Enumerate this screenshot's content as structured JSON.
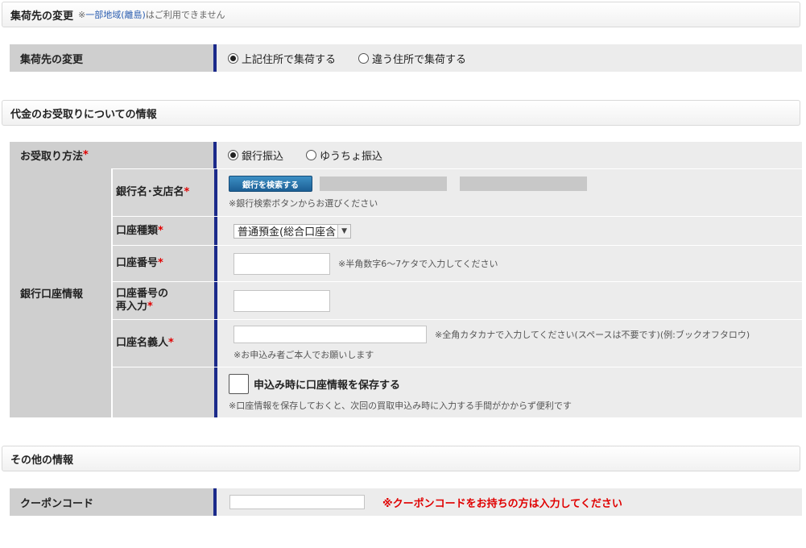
{
  "pickup": {
    "header_title": "集荷先の変更",
    "header_note_prefix": "※",
    "header_note_link": "一部地域(離島)",
    "header_note_suffix": "はご利用できません",
    "row_label": "集荷先の変更",
    "options": [
      {
        "label": "上記住所で集荷する",
        "selected": true
      },
      {
        "label": "違う住所で集荷する",
        "selected": false
      }
    ]
  },
  "payment": {
    "header_title": "代金のお受取りについての情報",
    "method_label": "お受取り方法",
    "required_mark": "*",
    "methods": [
      {
        "label": "銀行振込",
        "selected": true
      },
      {
        "label": "ゆうちょ振込",
        "selected": false
      }
    ]
  },
  "bank": {
    "group_label": "銀行口座情報",
    "bank_name_label": "銀行名･支店名",
    "search_button": "銀行を検索する",
    "search_hint": "※銀行検索ボタンからお選びください",
    "account_type_label": "口座種類",
    "account_type_value": "普通預金(総合口座含",
    "account_number_label": "口座番号",
    "account_number_hint": "※半角数字6〜7ケタで入力してください",
    "account_number_value": "",
    "reenter_label_line1": "口座番号の",
    "reenter_label_line2": "再入力",
    "reenter_value": "",
    "holder_label": "口座名義人",
    "holder_hint": "※全角カタカナで入力してください(スペースは不要です)(例:ブックオフタロウ)",
    "holder_note": "※お申込み者ご本人でお願いします",
    "holder_value": "",
    "save_label": "申込み時に口座情報を保存する",
    "save_checked": false,
    "save_hint": "※口座情報を保存しておくと、次回の買取申込み時に入力する手間がかからず便利です"
  },
  "other": {
    "header_title": "その他の情報",
    "coupon_label": "クーポンコード",
    "coupon_value": "",
    "coupon_hint": "※クーポンコードをお持ちの方は入力してください"
  },
  "colors": {
    "label_bg": "#cfcfcf",
    "value_bg": "#ececec",
    "accent_bar": "#1b2a8a",
    "required": "#e00000",
    "button": "#1c5f95"
  }
}
